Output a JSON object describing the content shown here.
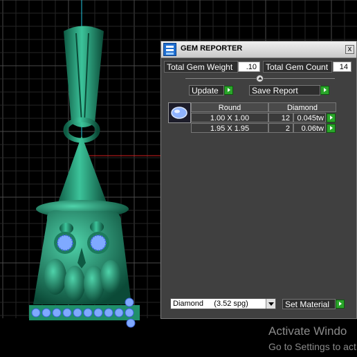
{
  "window": {
    "title": "GEM REPORTER",
    "close_label": "x"
  },
  "totals": {
    "weight_label": "Total Gem Weight",
    "weight_value": ".10",
    "count_label": "Total Gem Count",
    "count_value": "14"
  },
  "actions": {
    "update_label": "Update",
    "save_report_label": "Save Report"
  },
  "gem_table": {
    "shape_header": "Round",
    "material_header": "Diamond",
    "rows": [
      {
        "size": "1.00 X 1.00",
        "count": "12",
        "weight": "0.045tw"
      },
      {
        "size": "1.95 X 1.95",
        "count": "2",
        "weight": "0.06tw"
      }
    ]
  },
  "material": {
    "selected": "Diamond     (3.52 spg)",
    "set_material_label": "Set Material"
  },
  "watermark": {
    "line1": "Activate Windo",
    "line2": "Go to Settings to act"
  },
  "colors": {
    "model_green": "#1f8f6a",
    "gem_blue": "#7fa9ff",
    "axis_red": "#d22020",
    "axis_cyan": "#22c8e0",
    "ok_green": "#2aa52a"
  }
}
